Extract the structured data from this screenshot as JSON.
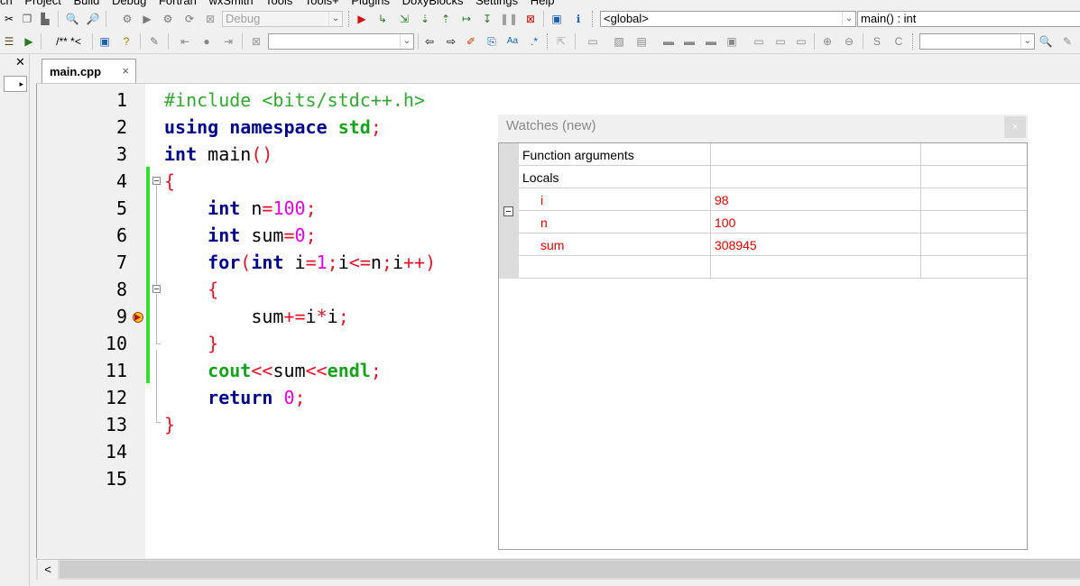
{
  "menu": [
    "ch",
    "Project",
    "Build",
    "Debug",
    "Fortran",
    "wxSmith",
    "Tools",
    "Tools+",
    "Plugins",
    "DoxyBlocks",
    "Settings",
    "Help"
  ],
  "toolbar": {
    "build_target": "Debug",
    "scope_combo": "<global>",
    "function_combo": "main() : int",
    "doxy_comment": "/** *<",
    "search_field": "",
    "second_search": ""
  },
  "left_panel": {
    "close": "✕",
    "arrow": "▸"
  },
  "tabs": [
    {
      "label": "main.cpp",
      "close": "×"
    }
  ],
  "editor": {
    "line_numbers": [
      "1",
      "2",
      "3",
      "4",
      "5",
      "6",
      "7",
      "8",
      "9",
      "10",
      "11",
      "12",
      "13",
      "14",
      "15"
    ],
    "code": {
      "l1": "#include <bits/stdc++.h>",
      "l2_kw1": "using",
      "l2_kw2": "namespace",
      "l2_kw3": "std",
      "l2_semi": ";",
      "l3_type": "int",
      "l3_name": " main",
      "l3_paren": "()",
      "l4": "{",
      "l5_type": "int",
      "l5_id": " n",
      "l5_eq": "=",
      "l5_num": "100",
      "l5_semi": ";",
      "l6_type": "int",
      "l6_id": " sum",
      "l6_eq": "=",
      "l6_num": "0",
      "l6_semi": ";",
      "l7_kw": "for",
      "l7_p": "(",
      "l7_type": "int",
      "l7_i": " i",
      "l7_eq": "=",
      "l7_one": "1",
      "l7_s1": ";",
      "l7_i2": "i",
      "l7_le": "<=",
      "l7_n": "n",
      "l7_s2": ";",
      "l7_i3": "i",
      "l7_pp": "++)",
      "l8": "{",
      "l9_sum": "sum",
      "l9_op": "+=",
      "l9_i": "i",
      "l9_mul": "*",
      "l9_i2": "i",
      "l9_semi": ";",
      "l10": "}",
      "l11_cout": "cout",
      "l11_op1": "<<",
      "l11_sum": "sum",
      "l11_op2": "<<",
      "l11_endl": "endl",
      "l11_semi": ";",
      "l12_kw": "return",
      "l12_num": " 0",
      "l12_semi": ";",
      "l13": "}"
    }
  },
  "watches": {
    "title": "Watches (new)",
    "close": "×",
    "rows": [
      {
        "name": "Function arguments",
        "value": "",
        "extra": ""
      },
      {
        "name": "Locals",
        "value": "",
        "extra": ""
      },
      {
        "name": "i",
        "value": "98",
        "extra": ""
      },
      {
        "name": "n",
        "value": "100",
        "extra": ""
      },
      {
        "name": "sum",
        "value": "308945",
        "extra": ""
      },
      {
        "name": "",
        "value": "",
        "extra": ""
      }
    ]
  },
  "scrollbar": {
    "left_arrow": "<"
  }
}
